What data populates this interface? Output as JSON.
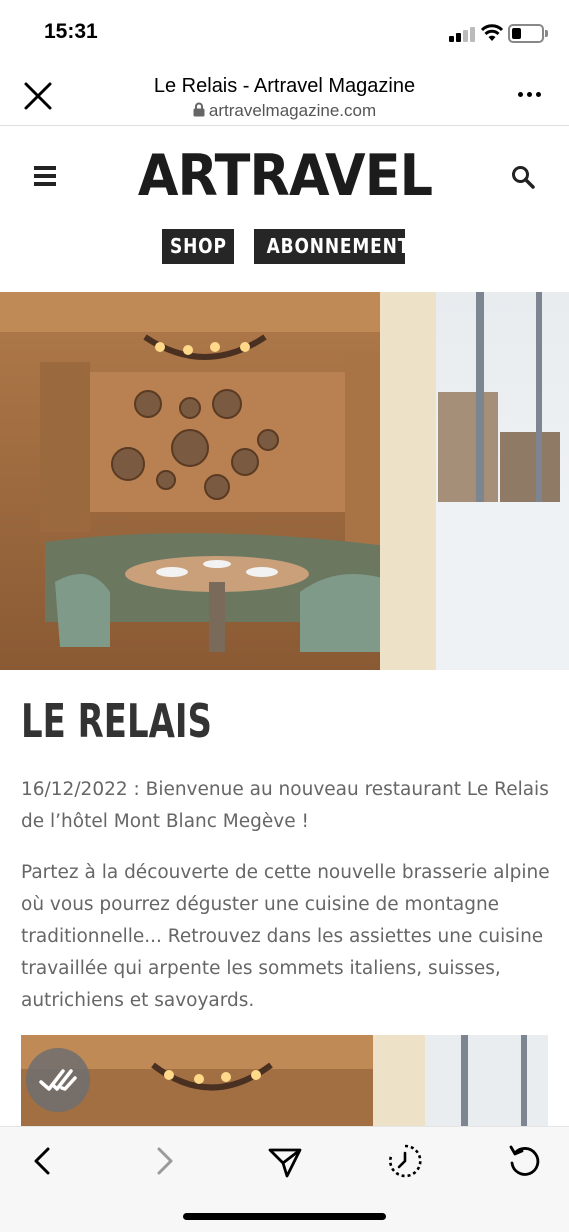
{
  "status": {
    "time": "15:31"
  },
  "browser": {
    "title": "Le Relais - Artravel Magazine",
    "url": "artravelmagazine.com"
  },
  "site": {
    "logo": "ARTRAVEL",
    "buttons": {
      "shop": "SHOP",
      "subscribe": "ABONNEMENT"
    }
  },
  "article": {
    "title": "LE RELAIS",
    "intro_lines": [
      "16/12/2022 : Bienvenue au nouveau restaurant Le Relais",
      "de l’hôtel Mont Blanc Megève !"
    ],
    "body_lines": [
      "Partez à la découverte de cette nouvelle brasserie alpine",
      "où vous pourrez déguster une cuisine de montagne",
      "traditionnelle... Retrouvez dans les assiettes une cuisine",
      "travaillée qui arpente les sommets italiens, suisses,",
      "autrichiens et savoyards."
    ]
  },
  "icons": {
    "close": "close-icon",
    "lock": "lock-icon",
    "more": "more-icon",
    "menu": "hamburger-menu-icon",
    "search": "search-icon",
    "back": "chevron-left-icon",
    "forward": "chevron-right-icon",
    "share": "send-icon",
    "history": "history-icon",
    "reload": "reload-icon",
    "check": "double-check-icon"
  },
  "colors": {
    "text": "#333333",
    "body_text": "#666666",
    "button_bg": "#262626",
    "toolbar_bg": "#f7f7f7"
  }
}
